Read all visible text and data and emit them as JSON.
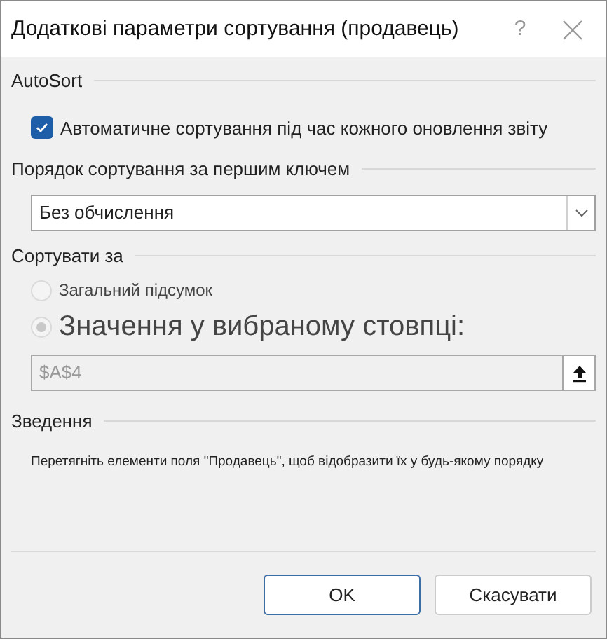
{
  "window": {
    "title": "Додаткові параметри сортування (продавець)",
    "help": "?"
  },
  "autosort": {
    "heading": "AutoSort",
    "checkbox": {
      "label": "Автоматичне сортування під час кожного оновлення звіту",
      "checked": true
    }
  },
  "first_key": {
    "heading": "Порядок сортування за першим ключем",
    "value": "Без обчислення"
  },
  "sort_by": {
    "heading": "Сортувати за",
    "options": [
      {
        "label": "Загальний підсумок",
        "selected": false,
        "disabled": true,
        "kind": "small"
      },
      {
        "label": "Значення у вибраному стовпці:",
        "selected": true,
        "disabled": true,
        "kind": "large"
      }
    ],
    "field": {
      "value": "$A$4",
      "disabled": true
    }
  },
  "summary": {
    "heading": "Зведення",
    "text": "Перетягніть елементи поля \"Продавець\", щоб відобразити їх у будь-якому порядку"
  },
  "buttons": [
    {
      "label": "OK",
      "default": true
    },
    {
      "label": "Скасувати",
      "default": false
    }
  ]
}
